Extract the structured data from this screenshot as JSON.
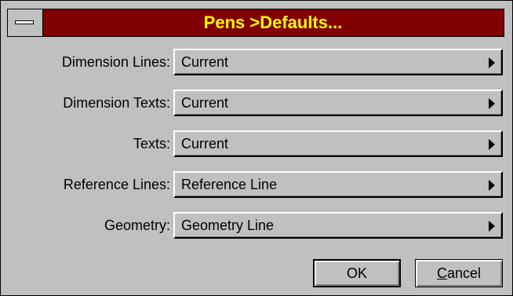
{
  "window": {
    "title": "Pens >Defaults..."
  },
  "rows": [
    {
      "label": "Dimension Lines:",
      "value": "Current"
    },
    {
      "label": "Dimension Texts:",
      "value": "Current"
    },
    {
      "label": "Texts:",
      "value": "Current"
    },
    {
      "label": "Reference Lines:",
      "value": "Reference Line"
    },
    {
      "label": "Geometry:",
      "value": "Geometry Line"
    }
  ],
  "buttons": {
    "ok": "OK",
    "cancel_first": "C",
    "cancel_rest": "ancel"
  },
  "colors": {
    "titlebar": "#800000",
    "title_text": "#ffff00",
    "face": "#c0c0c0"
  },
  "icons": {
    "system_menu": "system-menu-icon",
    "popup_arrow": "right-triangle-icon"
  }
}
